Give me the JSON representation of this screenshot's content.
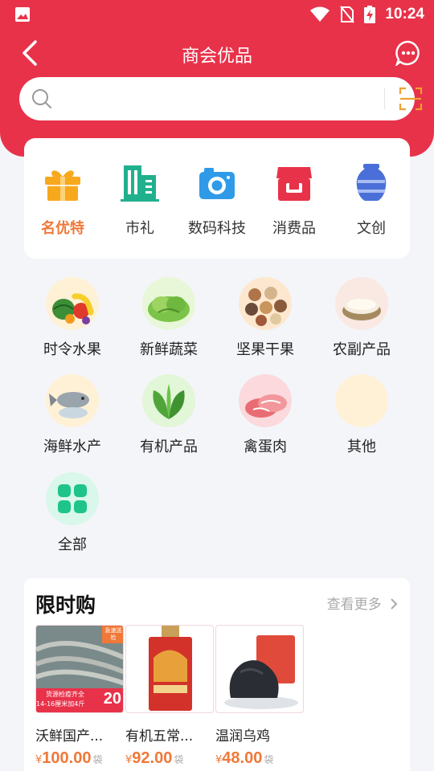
{
  "status_bar": {
    "time": "10:24"
  },
  "nav": {
    "title": "商会优品"
  },
  "search": {
    "placeholder": ""
  },
  "categories": [
    {
      "label": "名优特",
      "icon": "gift-icon",
      "active": true
    },
    {
      "label": "市礼",
      "icon": "building-icon",
      "active": false
    },
    {
      "label": "数码科技",
      "icon": "camera-icon",
      "active": false
    },
    {
      "label": "消费品",
      "icon": "store-icon",
      "active": false
    },
    {
      "label": "文创",
      "icon": "vase-icon",
      "active": false
    }
  ],
  "subcategories": [
    {
      "label": "时令水果"
    },
    {
      "label": "新鲜蔬菜"
    },
    {
      "label": "坚果干果"
    },
    {
      "label": "农副产品"
    },
    {
      "label": "海鲜水产"
    },
    {
      "label": "有机产品"
    },
    {
      "label": "禽蛋肉"
    },
    {
      "label": "其他"
    },
    {
      "label": "全部"
    }
  ],
  "flash_sale": {
    "title": "限时购",
    "more": "查看更多",
    "products": [
      {
        "name": "沃鲜国产...",
        "currency": "¥",
        "price": "100.00",
        "unit": "袋",
        "badge_top": "急速送检",
        "badge_bottom": "货源检疫齐全",
        "badge_size": "14-16厘米加4斤",
        "badge_num": "20"
      },
      {
        "name": "有机五常...",
        "currency": "¥",
        "price": "92.00",
        "unit": "袋"
      },
      {
        "name": "温润乌鸡",
        "currency": "¥",
        "price": "48.00",
        "unit": "袋"
      }
    ]
  },
  "colors": {
    "brand_red": "#e8324a",
    "accent_orange": "#f07838"
  }
}
